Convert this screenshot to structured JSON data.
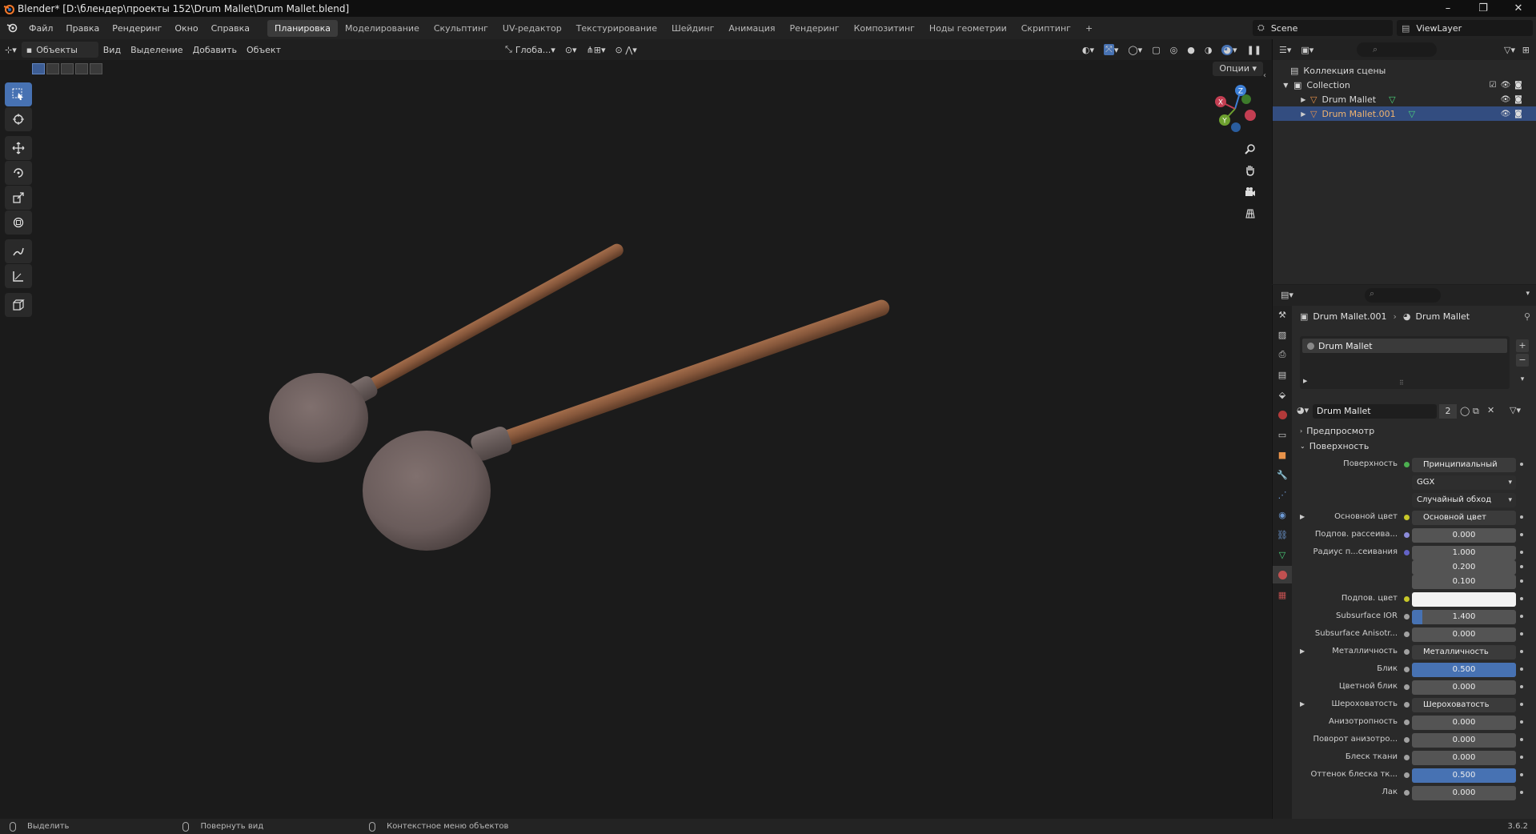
{
  "window": {
    "title": "Blender* [D:\\блендер\\проекты 152\\Drum Mallet\\Drum Mallet.blend]",
    "controls": [
      "–",
      "❐",
      "✕"
    ]
  },
  "menu": {
    "items": [
      "Файл",
      "Правка",
      "Рендеринг",
      "Окно",
      "Справка"
    ],
    "workspaces": [
      "Планировка",
      "Моделирование",
      "Скульптинг",
      "UV-редактор",
      "Текстурирование",
      "Шейдинг",
      "Анимация",
      "Рендеринг",
      "Композитинг",
      "Ноды геометрии",
      "Скриптинг"
    ],
    "active_workspace": "Планировка",
    "add_tab": "+",
    "scene": "Scene",
    "view_layer": "ViewLayer"
  },
  "viewport_header": {
    "mode": "Объекты",
    "menus": [
      "Вид",
      "Выделение",
      "Добавить",
      "Объект"
    ],
    "orientation": "Глоба...",
    "options": "Опции"
  },
  "outliner": {
    "root": "Коллекция сцены",
    "collection": "Collection",
    "objects": [
      {
        "name": "Drum Mallet",
        "selected": false
      },
      {
        "name": "Drum Mallet.001",
        "selected": true
      }
    ]
  },
  "properties": {
    "breadcrumb_object": "Drum Mallet.001",
    "breadcrumb_material": "Drum Mallet",
    "slot_name": "Drum Mallet",
    "material_name": "Drum Mallet",
    "users": "2",
    "panel_preview": "Предпросмотр",
    "panel_surface": "Поверхность",
    "rows": [
      {
        "label": "Поверхность",
        "value": "Принципиальный BSDF",
        "kind": "link",
        "socket": "#4caf50"
      },
      {
        "label": "",
        "value": "GGX",
        "kind": "dark",
        "socket": ""
      },
      {
        "label": "",
        "value": "Случайный обход",
        "kind": "dark",
        "socket": ""
      },
      {
        "label": "Основной цвет",
        "value": "Основной цвет",
        "kind": "link",
        "socket": "#c7c729",
        "expand": true
      },
      {
        "label": "Подпов. рассеива...",
        "value": "0.000",
        "kind": "num",
        "socket": "#8c8cd9"
      },
      {
        "label": "Радиус п...сеивания",
        "value": "1.000",
        "kind": "num",
        "socket": "#6363c7"
      },
      {
        "label": "",
        "value": "0.200",
        "kind": "num",
        "socket": ""
      },
      {
        "label": "",
        "value": "0.100",
        "kind": "num",
        "socket": ""
      },
      {
        "label": "Подпов. цвет",
        "value": "",
        "kind": "color",
        "socket": "#c7c729"
      },
      {
        "label": "Subsurface IOR",
        "value": "1.400",
        "kind": "num",
        "socket": "#a1a1a1",
        "fill": 0.1
      },
      {
        "label": "Subsurface Anisotr...",
        "value": "0.000",
        "kind": "num",
        "socket": "#a1a1a1"
      },
      {
        "label": "Металличность",
        "value": "Металличность",
        "kind": "link",
        "socket": "#a1a1a1",
        "expand": true
      },
      {
        "label": "Блик",
        "value": "0.500",
        "kind": "num",
        "socket": "#a1a1a1",
        "fill": 1.0
      },
      {
        "label": "Цветной блик",
        "value": "0.000",
        "kind": "num",
        "socket": "#a1a1a1"
      },
      {
        "label": "Шероховатость",
        "value": "Шероховатость",
        "kind": "link",
        "socket": "#a1a1a1",
        "expand": true
      },
      {
        "label": "Анизотропность",
        "value": "0.000",
        "kind": "num",
        "socket": "#a1a1a1"
      },
      {
        "label": "Поворот анизотро...",
        "value": "0.000",
        "kind": "num",
        "socket": "#a1a1a1"
      },
      {
        "label": "Блеск ткани",
        "value": "0.000",
        "kind": "num",
        "socket": "#a1a1a1"
      },
      {
        "label": "Оттенок блеска тк...",
        "value": "0.500",
        "kind": "num",
        "socket": "#a1a1a1",
        "fill": 1.0
      },
      {
        "label": "Лак",
        "value": "0.000",
        "kind": "num",
        "socket": "#a1a1a1"
      }
    ]
  },
  "statusbar": {
    "select": "Выделить",
    "rotate": "Повернуть вид",
    "context": "Контекстное меню объектов",
    "version": "3.6.2"
  },
  "gizmo": {
    "x": "X",
    "y": "Y",
    "z": "Z"
  },
  "colors": {
    "accent": "#4772b3",
    "selected_row": "#334d80",
    "mallet_head": "#6f6160",
    "mallet_handle": "#8a5a3e",
    "background": "#1b1b1b"
  }
}
